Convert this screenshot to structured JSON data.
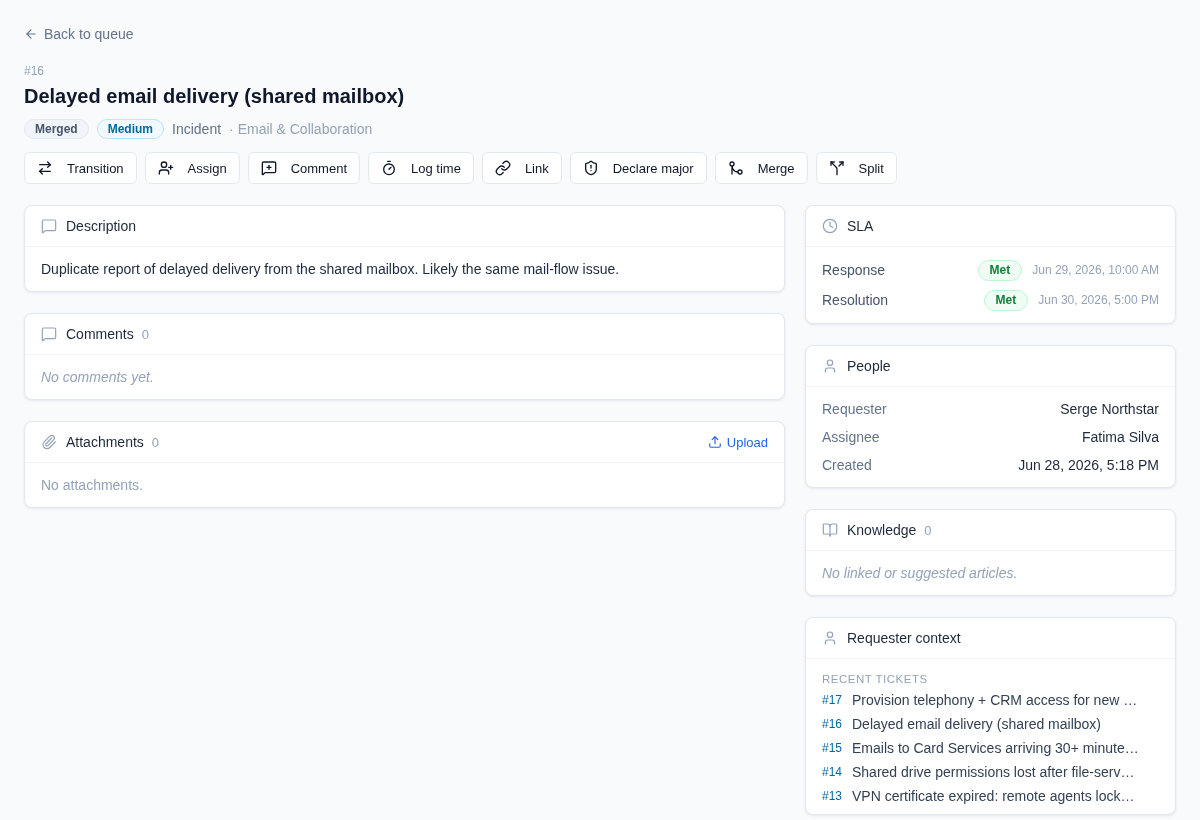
{
  "back_link": {
    "label": "Back to queue"
  },
  "ticket": {
    "number": "#16",
    "title": "Delayed email delivery (shared mailbox)",
    "badges": [
      {
        "label": "Merged",
        "kind": "status"
      },
      {
        "label": "Medium",
        "kind": "priority"
      }
    ],
    "type": "Incident",
    "category": "· Email & Collaboration"
  },
  "actions": [
    {
      "label": "Transition"
    },
    {
      "label": "Assign"
    },
    {
      "label": "Comment"
    },
    {
      "label": "Log time"
    },
    {
      "label": "Link"
    },
    {
      "label": "Declare major"
    },
    {
      "label": "Merge"
    },
    {
      "label": "Split"
    }
  ],
  "description": {
    "title": "Description",
    "text": "Duplicate report of delayed delivery from the shared mailbox. Likely the same mail-flow issue."
  },
  "comments": {
    "title": "Comments",
    "count": "0",
    "empty_text": "No comments yet."
  },
  "attachments": {
    "title": "Attachments",
    "count": "0",
    "action": "Upload",
    "empty_text": "No attachments."
  },
  "sla": {
    "title": "SLA",
    "rows": [
      {
        "label": "Response",
        "status": "Met",
        "time": "Jun 29, 2026, 10:00 AM"
      },
      {
        "label": "Resolution",
        "status": "Met",
        "time": "Jun 30, 2026, 5:00 PM"
      }
    ]
  },
  "people": {
    "title": "People",
    "rows": [
      {
        "label": "Requester",
        "value": "Serge Northstar"
      },
      {
        "label": "Assignee",
        "value": "Fatima Silva"
      },
      {
        "label": "Created",
        "value": "Jun 28, 2026, 5:18 PM"
      }
    ]
  },
  "knowledge": {
    "title": "Knowledge",
    "count": "0",
    "empty_text": "No linked or suggested articles."
  },
  "requester_context": {
    "title": "Requester context",
    "section": "RECENT TICKETS",
    "tickets": [
      {
        "number": "#17",
        "title": "Provision telephony + CRM access for new …"
      },
      {
        "number": "#16",
        "title": "Delayed email delivery (shared mailbox)"
      },
      {
        "number": "#15",
        "title": "Emails to Card Services arriving 30+ minute…"
      },
      {
        "number": "#14",
        "title": "Shared drive permissions lost after file-serv…"
      },
      {
        "number": "#13",
        "title": "VPN certificate expired: remote agents lock…"
      }
    ]
  }
}
